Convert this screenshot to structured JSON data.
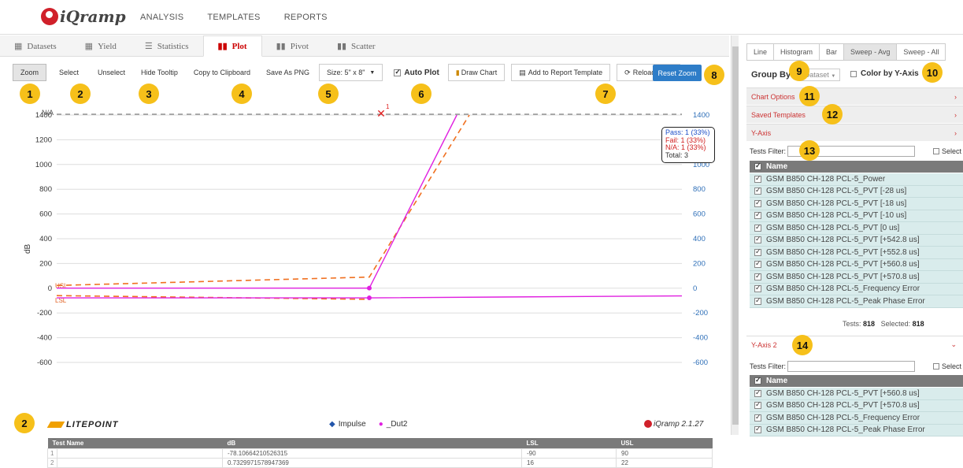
{
  "app": {
    "name": "iQramp",
    "nav": [
      "ANALYSIS",
      "TEMPLATES",
      "REPORTS"
    ]
  },
  "tabs": [
    {
      "label": "Datasets",
      "icon": "grid-icon"
    },
    {
      "label": "Yield",
      "icon": "grid-icon"
    },
    {
      "label": "Statistics",
      "icon": "list-icon"
    },
    {
      "label": "Plot",
      "icon": "bar-chart-icon",
      "active": true
    },
    {
      "label": "Pivot",
      "icon": "bar-chart-icon"
    },
    {
      "label": "Scatter",
      "icon": "bar-chart-icon"
    }
  ],
  "toolbar": {
    "zoom": "Zoom",
    "select": "Select",
    "unselect": "Unselect",
    "hide_tooltip": "Hide Tooltip",
    "copy": "Copy to Clipboard",
    "save_png": "Save As PNG",
    "size": "Size: 5\" x 8\"",
    "auto_plot": "Auto Plot",
    "draw_chart": "Draw Chart",
    "add_report": "Add to Report Template",
    "reload": "Reload Data",
    "reset_zoom": "Reset Zoom"
  },
  "badges": {
    "b1": "1",
    "b2": "2",
    "b3": "3",
    "b4": "4",
    "b5": "5",
    "b6": "6",
    "b7": "7",
    "b8": "8",
    "b9": "9",
    "b10": "10",
    "b11": "11",
    "b12": "12",
    "b13": "13",
    "b14": "14",
    "b2b": "2"
  },
  "summary": {
    "pass": "Pass:  1 (33%)",
    "fail": "Fail:   1 (33%)",
    "na": "N/A:   1 (33%)",
    "total": "Total:  3"
  },
  "chart_data": {
    "type": "line",
    "ylabel": "dB",
    "ylim": [
      -700,
      1500
    ],
    "yticks": [
      -600,
      -400,
      -200,
      0,
      200,
      400,
      600,
      800,
      1000,
      1200,
      1400
    ],
    "na_label": "N/A",
    "usl_label": "USL",
    "lsl_label": "LSL",
    "na_marker_label": "1",
    "series": [
      {
        "name": "Impulse",
        "color": "#2255aa",
        "marker": "diamond",
        "points": []
      },
      {
        "name": "_Dut2",
        "color": "#e020e0",
        "marker": "circle",
        "points": [
          [
            0,
            0.73
          ],
          [
            0.5,
            0.73
          ],
          [
            0.64,
            1400
          ]
        ]
      },
      {
        "name": "_Dut2 LSL",
        "color": "#e020e0",
        "marker": "circle",
        "points": [
          [
            0,
            -78.1
          ],
          [
            0.5,
            -78.1
          ],
          [
            1.0,
            -62
          ]
        ]
      }
    ],
    "limits": [
      {
        "kind": "USL",
        "color": "#f07020",
        "points": [
          [
            0,
            22
          ],
          [
            0.5,
            90
          ],
          [
            0.66,
            1400
          ]
        ]
      },
      {
        "kind": "LSL",
        "color": "#f07020",
        "points": [
          [
            0,
            -60
          ],
          [
            0.5,
            -90
          ]
        ]
      }
    ]
  },
  "legend": {
    "impulse": "Impulse",
    "dut2": "_Dut2",
    "litepoint": "LITEPOINT",
    "version": "iQramp 2.1.27"
  },
  "table": {
    "headers": [
      "Test Name",
      "dB",
      "LSL",
      "USL"
    ],
    "rows": [
      {
        "idx": "1",
        "name": "",
        "db": "-78.10664210526315",
        "lsl": "-90",
        "usl": "90"
      },
      {
        "idx": "2",
        "name": "",
        "db": "0.7329971578947369",
        "lsl": "16",
        "usl": "22"
      }
    ]
  },
  "right": {
    "chart_types": [
      "Line",
      "Histogram",
      "Bar",
      "Sweep - Avg",
      "Sweep - All"
    ],
    "active_type": "Sweep - Avg",
    "group_by": "Group By:",
    "group_value": "Dataset",
    "color_by": "Color by Y-Axis",
    "chart_options": "Chart Options",
    "saved_templates": "Saved Templates",
    "y_axis": "Y-Axis",
    "y_axis2": "Y-Axis 2",
    "tests_filter": "Tests Filter:",
    "select_all": "Select",
    "name_header": "Name",
    "tests_label": "Tests:",
    "tests_count": "818",
    "selected_label": "Selected:",
    "selected_count": "818",
    "y_items": [
      "GSM B850 CH-128 PCL-5_Power",
      "GSM B850 CH-128 PCL-5_PVT [-28 us]",
      "GSM B850 CH-128 PCL-5_PVT [-18 us]",
      "GSM B850 CH-128 PCL-5_PVT [-10 us]",
      "GSM B850 CH-128 PCL-5_PVT [0 us]",
      "GSM B850 CH-128 PCL-5_PVT [+542.8 us]",
      "GSM B850 CH-128 PCL-5_PVT [+552.8 us]",
      "GSM B850 CH-128 PCL-5_PVT [+560.8 us]",
      "GSM B850 CH-128 PCL-5_PVT [+570.8 us]",
      "GSM B850 CH-128 PCL-5_Frequency Error",
      "GSM B850 CH-128 PCL-5_Peak Phase Error"
    ],
    "y2_items": [
      "GSM B850 CH-128 PCL-5_PVT [+560.8 us]",
      "GSM B850 CH-128 PCL-5_PVT [+570.8 us]",
      "GSM B850 CH-128 PCL-5_Frequency Error",
      "GSM B850 CH-128 PCL-5_Peak Phase Error"
    ]
  }
}
